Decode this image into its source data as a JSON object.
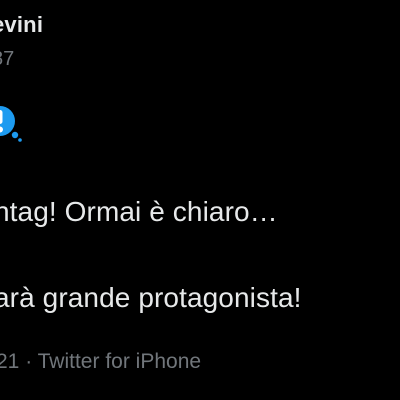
{
  "tweet": {
    "display_name": "evini",
    "handle": "87",
    "emoji_icon": "exclamation-speech-bubble-icon",
    "text_line_1": "htag! Ormai è chiaro…",
    "text_line_2": "arà grande protagonista!",
    "meta": "21 · Twitter for iPhone"
  },
  "colors": {
    "background": "#000000",
    "primary_text": "#e7e9ea",
    "secondary_text": "#71767b",
    "emoji_blue": "#1d9bf0"
  }
}
